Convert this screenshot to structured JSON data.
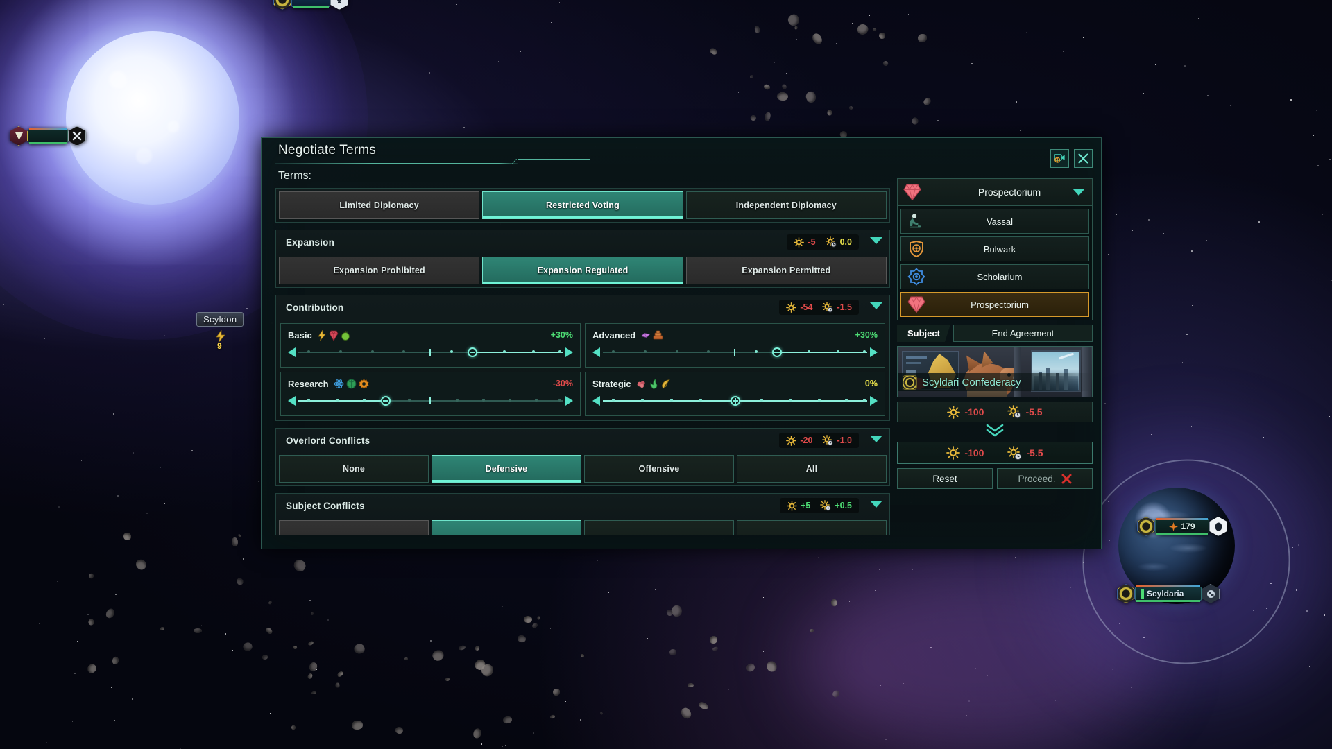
{
  "map": {
    "star_system_label": "Scyldon",
    "star_resource_value": "9",
    "planet_fleet_value": "179",
    "planet_label": "Scyldaria"
  },
  "window": {
    "title": "Negotiate Terms",
    "terms_label": "Terms:",
    "camera_icon": "camera-focus-icon",
    "close_icon": "close-icon"
  },
  "sections": [
    {
      "id": "diplomacy",
      "title": "",
      "has_costs": false,
      "options": [
        {
          "label": "Limited Diplomacy",
          "state": "normal"
        },
        {
          "label": "Restricted Voting",
          "state": "selected"
        },
        {
          "label": "Independent Diplomacy",
          "state": "dim"
        }
      ]
    },
    {
      "id": "expansion",
      "title": "Expansion",
      "has_costs": true,
      "cost_flat": "-5",
      "cost_flat_sign": "neg",
      "cost_monthly": "0.0",
      "cost_monthly_sign": "zero",
      "options": [
        {
          "label": "Expansion Prohibited",
          "state": "normal"
        },
        {
          "label": "Expansion Regulated",
          "state": "selected"
        },
        {
          "label": "Expansion Permitted",
          "state": "normal"
        }
      ]
    },
    {
      "id": "contribution",
      "title": "Contribution",
      "has_costs": true,
      "cost_flat": "-54",
      "cost_flat_sign": "neg",
      "cost_monthly": "-1.5",
      "cost_monthly_sign": "neg"
    },
    {
      "id": "overlord_conflicts",
      "title": "Overlord Conflicts",
      "has_costs": true,
      "cost_flat": "-20",
      "cost_flat_sign": "neg",
      "cost_monthly": "-1.0",
      "cost_monthly_sign": "neg",
      "options": [
        {
          "label": "None",
          "state": "dim"
        },
        {
          "label": "Defensive",
          "state": "selected"
        },
        {
          "label": "Offensive",
          "state": "dim"
        },
        {
          "label": "All",
          "state": "dim"
        }
      ]
    },
    {
      "id": "subject_conflicts",
      "title": "Subject Conflicts",
      "has_costs": true,
      "cost_flat": "+5",
      "cost_flat_sign": "pos",
      "cost_monthly": "+0.5",
      "cost_monthly_sign": "pos"
    }
  ],
  "sliders": [
    {
      "name": "Basic",
      "icons": [
        "energy-icon",
        "minerals-icon",
        "food-icon"
      ],
      "value": "+30%",
      "sign": "pos",
      "pos": 66,
      "mid": 50,
      "knob": "minus"
    },
    {
      "name": "Advanced",
      "icons": [
        "consumer-goods-icon",
        "alloys-icon"
      ],
      "value": "+30%",
      "sign": "pos",
      "pos": 66,
      "mid": 50,
      "knob": "minus"
    },
    {
      "name": "Research",
      "icons": [
        "physics-icon",
        "society-icon",
        "engineering-icon"
      ],
      "value": "-30%",
      "sign": "neg",
      "pos": 33,
      "mid": 50,
      "knob": "minus"
    },
    {
      "name": "Strategic",
      "icons": [
        "exotic-gases-icon",
        "rare-crystals-icon",
        "motes-icon"
      ],
      "value": "0%",
      "sign": "zero",
      "pos": 50,
      "mid": 50,
      "knob": "plus"
    }
  ],
  "right_panel": {
    "current_type": "Prospectorium",
    "current_type_icon": "prospectorium-gem-icon",
    "types": [
      {
        "label": "Vassal",
        "icon": "vassal-kneel-icon",
        "active": false
      },
      {
        "label": "Bulwark",
        "icon": "bulwark-shield-icon",
        "active": false
      },
      {
        "label": "Scholarium",
        "icon": "scholarium-eye-icon",
        "active": false
      },
      {
        "label": "Prospectorium",
        "icon": "prospectorium-gem-icon",
        "active": true
      }
    ],
    "tabs": [
      {
        "label": "Subject",
        "active": true
      },
      {
        "label": "End Agreement",
        "active": false
      }
    ],
    "subject_name": "Scyldari Confederacy",
    "cost_current": {
      "flat": "-100",
      "monthly": "-5.5"
    },
    "cost_new": {
      "flat": "-100",
      "monthly": "-5.5"
    },
    "reset_label": "Reset",
    "proceed_label": "Proceed.",
    "proceed_blocked_icon": "red-x-icon"
  },
  "colors": {
    "accent_teal": "#43d6bb",
    "selected_green": "#2f8575",
    "negative_red": "#e14b4b",
    "positive_green": "#4ddc74",
    "neutral_yellow": "#e8e04a",
    "highlight_gold": "#d79a2b",
    "influence_gold": "#e8b93a"
  }
}
